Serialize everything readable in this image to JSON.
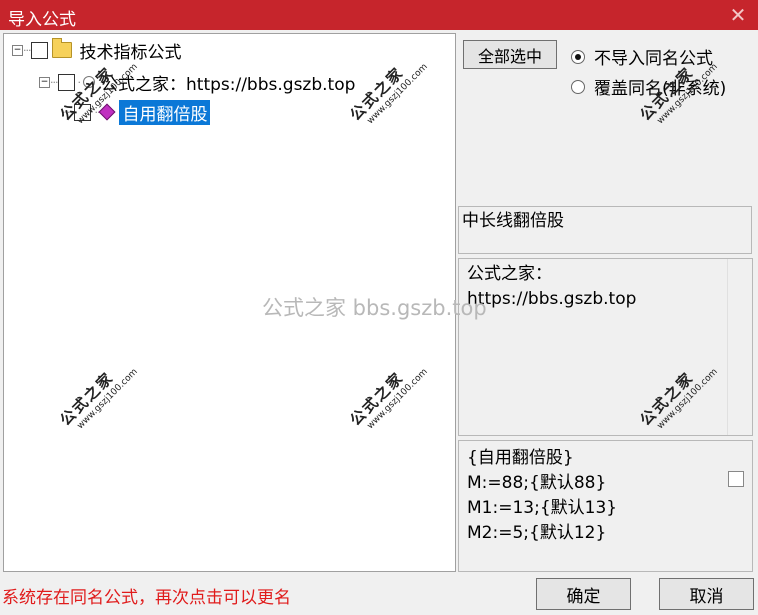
{
  "window": {
    "title": "导入公式",
    "close_glyph": "✕"
  },
  "tree": {
    "root": {
      "label": "技术指标公式",
      "expander": "−"
    },
    "level1": {
      "label": "公式之家：https://bbs.gszb.top",
      "expander": "−"
    },
    "level2": {
      "label": "自用翻倍股"
    }
  },
  "options": {
    "select_all_label": "全部选中",
    "radio_no_import": "不导入同名公式",
    "radio_overwrite": "覆盖同名(非系统)"
  },
  "info": {
    "name": "中长线翻倍股",
    "description": "公式之家：\nhttps://bbs.gszb.top",
    "params": "{自用翻倍股}\nM:=88;{默认88}\nM1:=13;{默认13}\nM2:=5;{默认12}"
  },
  "status": {
    "message": "系统存在同名公式，再次点击可以更名"
  },
  "footer": {
    "ok_label": "确定",
    "cancel_label": "取消"
  },
  "watermarks": {
    "center": "公式之家 bbs.gszb.top",
    "logo_text": "公式之家",
    "logo_url": "www.gszj100.com"
  },
  "colors": {
    "titlebar": "#c6252c",
    "selection": "#0b78d7",
    "status_text": "#e01b1b"
  }
}
